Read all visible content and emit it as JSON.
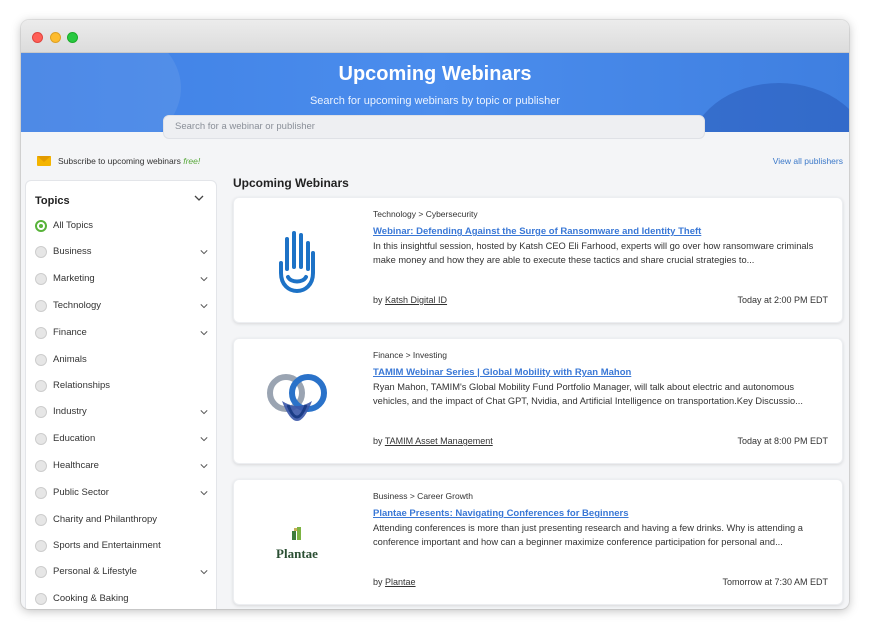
{
  "hero": {
    "title": "Upcoming Webinars",
    "subtitle": "Search for upcoming webinars by topic or publisher"
  },
  "search": {
    "placeholder": "Search for a webinar or publisher",
    "value": ""
  },
  "subscribe": {
    "text": "Subscribe to upcoming webinars ",
    "free": "free!",
    "icon": "mail-icon"
  },
  "view_all_label": "View all publishers",
  "sidebar": {
    "title": "Topics",
    "topics": [
      {
        "label": "All Topics",
        "active": true,
        "expandable": false
      },
      {
        "label": "Business",
        "active": false,
        "expandable": true
      },
      {
        "label": "Marketing",
        "active": false,
        "expandable": true
      },
      {
        "label": "Technology",
        "active": false,
        "expandable": true
      },
      {
        "label": "Finance",
        "active": false,
        "expandable": true
      },
      {
        "label": "Animals",
        "active": false,
        "expandable": false
      },
      {
        "label": "Relationships",
        "active": false,
        "expandable": false
      },
      {
        "label": "Industry",
        "active": false,
        "expandable": true
      },
      {
        "label": "Education",
        "active": false,
        "expandable": true
      },
      {
        "label": "Healthcare",
        "active": false,
        "expandable": true
      },
      {
        "label": "Public Sector",
        "active": false,
        "expandable": true
      },
      {
        "label": "Charity and Philanthropy",
        "active": false,
        "expandable": false
      },
      {
        "label": "Sports and Entertainment",
        "active": false,
        "expandable": false
      },
      {
        "label": "Personal & Lifestyle",
        "active": false,
        "expandable": true
      },
      {
        "label": "Cooking & Baking",
        "active": false,
        "expandable": false
      }
    ]
  },
  "main": {
    "title": "Upcoming Webinars",
    "webinars": [
      {
        "category": "Technology > Cybersecurity",
        "title": "Webinar: Defending Against the Surge of Ransomware and Identity Theft",
        "description": "In this insightful session, hosted by Katsh CEO Eli Farhood, experts will go over how ransomware criminals make money and how they are able to execute these tactics and share crucial strategies to...",
        "by": "by ",
        "publisher": "Katsh Digital ID",
        "time": "Today at 2:00 PM EDT",
        "logo": "katsh-hand-logo"
      },
      {
        "category": "Finance > Investing",
        "title": "TAMIM Webinar Series | Global Mobility with Ryan Mahon",
        "description": "Ryan Mahon, TAMIM's Global Mobility Fund Portfolio Manager, will talk about electric and autonomous vehicles, and the impact of Chat GPT, Nvidia, and Artificial Intelligence on transportation.Key Discussio...",
        "by": "by ",
        "publisher": "TAMIM Asset Management",
        "time": "Today at 8:00 PM EDT",
        "logo": "tamim-knot-logo"
      },
      {
        "category": "Business > Career Growth",
        "title": "Plantae Presents: Navigating Conferences for Beginners",
        "description": "Attending conferences is more than just presenting research and having a few drinks. Why is attending a conference important and how can a beginner maximize conference participation for personal and...",
        "by": "by ",
        "publisher": "Plantae",
        "time": "Tomorrow at 7:30 AM EDT",
        "logo": "plantae-logo",
        "logo_text": "Plantae"
      }
    ]
  },
  "colors": {
    "accent": "#3a78d6",
    "hero": "#4b8ded",
    "active_green": "#58b33a"
  }
}
